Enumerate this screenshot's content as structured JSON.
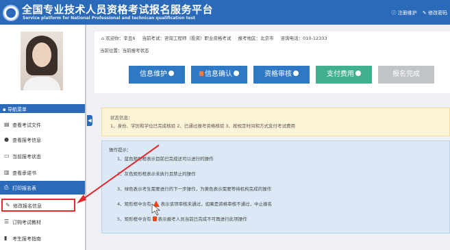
{
  "header": {
    "logo_text": "PTA",
    "title": "全国专业技术人员资格考试报名服务平台",
    "subtitle": "Service platform for National Professional and technican qualification test",
    "links": [
      "注册维护",
      "修改密码"
    ]
  },
  "infobar": {
    "welcome_label": "欢迎你：",
    "user_name": "辛丑6",
    "exam_label": "当前考试：",
    "exam_name": "咨询工程师（投资）职业资格考试",
    "region_label": "报考地区：",
    "region_value": "北京市",
    "phone_label": "咨询电话：",
    "phone_value": "010-12333",
    "location": "当前位置：当前报考状态"
  },
  "steps": [
    {
      "label": "信息维护",
      "color": "#2f78c4"
    },
    {
      "label": "信息确认",
      "color": "#2f78c4"
    },
    {
      "label": "资格审核",
      "color": "#2f78c4"
    },
    {
      "label": "支付费用",
      "color": "#41b08e"
    },
    {
      "label": "报名完成",
      "color": "#c0c3c8"
    }
  ],
  "sidebar": {
    "nav_header": "导航菜单",
    "items": [
      {
        "label": "查看考试文件",
        "icon": "file-icon"
      },
      {
        "label": "查看报考信息",
        "icon": "info-icon"
      },
      {
        "label": "当前报考状态",
        "icon": "monitor-icon"
      },
      {
        "label": "查看承诺书",
        "icon": "book-icon"
      },
      {
        "label": "打印报名表",
        "icon": "print-icon",
        "active": true
      },
      {
        "label": "修改报名信息",
        "icon": "edit-icon"
      },
      {
        "label": "订购考试教材",
        "icon": "cart-icon"
      },
      {
        "label": "考生报考指南",
        "icon": "guide-icon"
      }
    ]
  },
  "status": {
    "title": "状态信息：",
    "text": "1、身份、学历和学位已完成核验 2、已通过报考资格核验 3、按规定时间和方式支付考试费用"
  },
  "operations": {
    "title": "操作提示：",
    "rows": [
      {
        "num": "1、",
        "text": "蓝色矩形框表示目前已完成还可以进行的操作"
      },
      {
        "num": "2、",
        "text": "灰色矩形框表示未执行且禁止的操作"
      },
      {
        "num": "3、",
        "text": "绿色表示考生需要进行的下一步操作，为黄色表示需要等待机构完成的操作"
      },
      {
        "num": "4、",
        "pre": "矩形框中含有",
        "post": "表示该项审核未通过，如果是资格审核不通过，中止报名"
      },
      {
        "num": "5、",
        "pre": "矩形框中含有",
        "post": "表示报考人员当前已完成不可再进行此项操作"
      }
    ]
  },
  "colors": {
    "brand": "#2a6ab8",
    "annotation_red": "#e3262a"
  }
}
